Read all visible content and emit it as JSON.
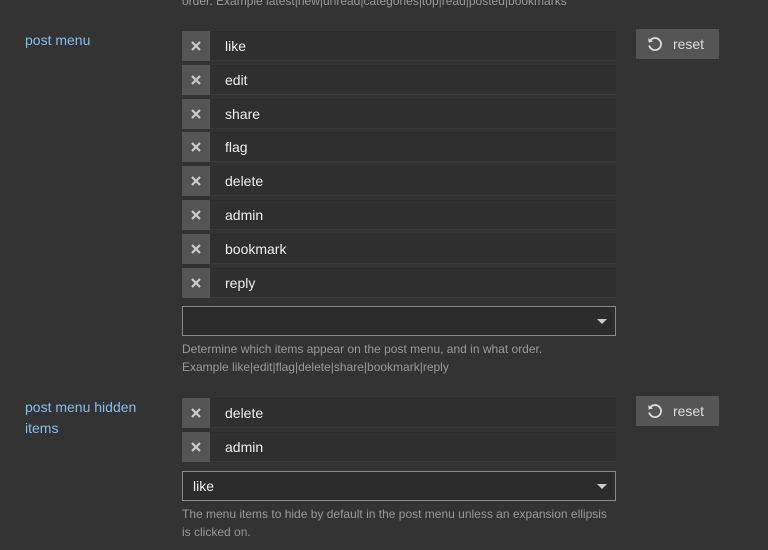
{
  "prev_setting": {
    "desc_tail": "order. Example latest|new|unread|categories|top|read|posted|bookmarks"
  },
  "post_menu": {
    "label": "post menu",
    "items": [
      "like",
      "edit",
      "share",
      "flag",
      "delete",
      "admin",
      "bookmark",
      "reply"
    ],
    "select_value": "",
    "desc_line1": "Determine which items appear on the post menu, and in what order.",
    "desc_line2": "Example like|edit|flag|delete|share|bookmark|reply",
    "reset_label": "reset"
  },
  "post_menu_hidden": {
    "label": "post menu hidden items",
    "items": [
      "delete",
      "admin"
    ],
    "select_value": "like",
    "desc": "The menu items to hide by default in the post menu unless an expansion ellipsis is clicked on.",
    "reset_label": "reset"
  },
  "icons": {
    "remove": "close-icon",
    "reset": "undo-icon",
    "dropdown": "caret-down-icon"
  }
}
